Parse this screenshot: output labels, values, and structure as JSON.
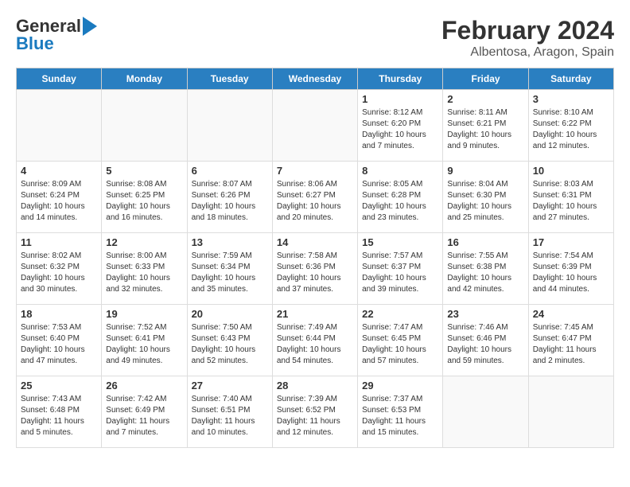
{
  "logo": {
    "line1": "General",
    "line2": "Blue"
  },
  "title": "February 2024",
  "subtitle": "Albentosa, Aragon, Spain",
  "days_of_week": [
    "Sunday",
    "Monday",
    "Tuesday",
    "Wednesday",
    "Thursday",
    "Friday",
    "Saturday"
  ],
  "weeks": [
    [
      {
        "num": "",
        "info": ""
      },
      {
        "num": "",
        "info": ""
      },
      {
        "num": "",
        "info": ""
      },
      {
        "num": "",
        "info": ""
      },
      {
        "num": "1",
        "info": "Sunrise: 8:12 AM\nSunset: 6:20 PM\nDaylight: 10 hours\nand 7 minutes."
      },
      {
        "num": "2",
        "info": "Sunrise: 8:11 AM\nSunset: 6:21 PM\nDaylight: 10 hours\nand 9 minutes."
      },
      {
        "num": "3",
        "info": "Sunrise: 8:10 AM\nSunset: 6:22 PM\nDaylight: 10 hours\nand 12 minutes."
      }
    ],
    [
      {
        "num": "4",
        "info": "Sunrise: 8:09 AM\nSunset: 6:24 PM\nDaylight: 10 hours\nand 14 minutes."
      },
      {
        "num": "5",
        "info": "Sunrise: 8:08 AM\nSunset: 6:25 PM\nDaylight: 10 hours\nand 16 minutes."
      },
      {
        "num": "6",
        "info": "Sunrise: 8:07 AM\nSunset: 6:26 PM\nDaylight: 10 hours\nand 18 minutes."
      },
      {
        "num": "7",
        "info": "Sunrise: 8:06 AM\nSunset: 6:27 PM\nDaylight: 10 hours\nand 20 minutes."
      },
      {
        "num": "8",
        "info": "Sunrise: 8:05 AM\nSunset: 6:28 PM\nDaylight: 10 hours\nand 23 minutes."
      },
      {
        "num": "9",
        "info": "Sunrise: 8:04 AM\nSunset: 6:30 PM\nDaylight: 10 hours\nand 25 minutes."
      },
      {
        "num": "10",
        "info": "Sunrise: 8:03 AM\nSunset: 6:31 PM\nDaylight: 10 hours\nand 27 minutes."
      }
    ],
    [
      {
        "num": "11",
        "info": "Sunrise: 8:02 AM\nSunset: 6:32 PM\nDaylight: 10 hours\nand 30 minutes."
      },
      {
        "num": "12",
        "info": "Sunrise: 8:00 AM\nSunset: 6:33 PM\nDaylight: 10 hours\nand 32 minutes."
      },
      {
        "num": "13",
        "info": "Sunrise: 7:59 AM\nSunset: 6:34 PM\nDaylight: 10 hours\nand 35 minutes."
      },
      {
        "num": "14",
        "info": "Sunrise: 7:58 AM\nSunset: 6:36 PM\nDaylight: 10 hours\nand 37 minutes."
      },
      {
        "num": "15",
        "info": "Sunrise: 7:57 AM\nSunset: 6:37 PM\nDaylight: 10 hours\nand 39 minutes."
      },
      {
        "num": "16",
        "info": "Sunrise: 7:55 AM\nSunset: 6:38 PM\nDaylight: 10 hours\nand 42 minutes."
      },
      {
        "num": "17",
        "info": "Sunrise: 7:54 AM\nSunset: 6:39 PM\nDaylight: 10 hours\nand 44 minutes."
      }
    ],
    [
      {
        "num": "18",
        "info": "Sunrise: 7:53 AM\nSunset: 6:40 PM\nDaylight: 10 hours\nand 47 minutes."
      },
      {
        "num": "19",
        "info": "Sunrise: 7:52 AM\nSunset: 6:41 PM\nDaylight: 10 hours\nand 49 minutes."
      },
      {
        "num": "20",
        "info": "Sunrise: 7:50 AM\nSunset: 6:43 PM\nDaylight: 10 hours\nand 52 minutes."
      },
      {
        "num": "21",
        "info": "Sunrise: 7:49 AM\nSunset: 6:44 PM\nDaylight: 10 hours\nand 54 minutes."
      },
      {
        "num": "22",
        "info": "Sunrise: 7:47 AM\nSunset: 6:45 PM\nDaylight: 10 hours\nand 57 minutes."
      },
      {
        "num": "23",
        "info": "Sunrise: 7:46 AM\nSunset: 6:46 PM\nDaylight: 10 hours\nand 59 minutes."
      },
      {
        "num": "24",
        "info": "Sunrise: 7:45 AM\nSunset: 6:47 PM\nDaylight: 11 hours\nand 2 minutes."
      }
    ],
    [
      {
        "num": "25",
        "info": "Sunrise: 7:43 AM\nSunset: 6:48 PM\nDaylight: 11 hours\nand 5 minutes."
      },
      {
        "num": "26",
        "info": "Sunrise: 7:42 AM\nSunset: 6:49 PM\nDaylight: 11 hours\nand 7 minutes."
      },
      {
        "num": "27",
        "info": "Sunrise: 7:40 AM\nSunset: 6:51 PM\nDaylight: 11 hours\nand 10 minutes."
      },
      {
        "num": "28",
        "info": "Sunrise: 7:39 AM\nSunset: 6:52 PM\nDaylight: 11 hours\nand 12 minutes."
      },
      {
        "num": "29",
        "info": "Sunrise: 7:37 AM\nSunset: 6:53 PM\nDaylight: 11 hours\nand 15 minutes."
      },
      {
        "num": "",
        "info": ""
      },
      {
        "num": "",
        "info": ""
      }
    ]
  ]
}
